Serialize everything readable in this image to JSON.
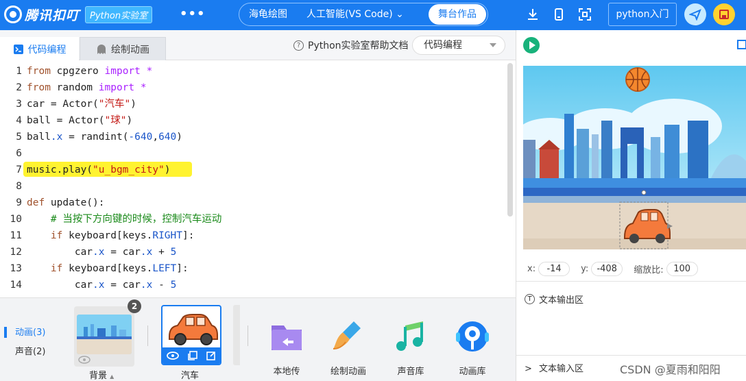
{
  "header": {
    "brand": "腾讯扣叮",
    "lab": "Python实验室",
    "more": "•••",
    "modes": [
      "海龟绘图",
      "人工智能(VS Code)",
      "舞台作品"
    ],
    "active_mode": "舞台作品",
    "python_btn": "python入门",
    "accent": "#1a7cf0"
  },
  "tabs": {
    "code_tab": "代码编程",
    "draw_tab": "绘制动画",
    "help": "Python实验室帮助文档",
    "select_value": "代码编程"
  },
  "code": [
    {
      "n": "1"
    },
    {
      "n": "2"
    },
    {
      "n": "3"
    },
    {
      "n": "4"
    },
    {
      "n": "5"
    },
    {
      "n": "6"
    },
    {
      "n": "7"
    },
    {
      "n": "8"
    },
    {
      "n": "9"
    },
    {
      "n": "10"
    },
    {
      "n": "11"
    },
    {
      "n": "12"
    },
    {
      "n": "13"
    },
    {
      "n": "14"
    }
  ],
  "code_text": {
    "l1": [
      "from",
      " cpgzero ",
      "import",
      " *"
    ],
    "l2": [
      "from",
      " random ",
      "import",
      " *"
    ],
    "l3": [
      "car = Actor(",
      "\"汽车\"",
      ")"
    ],
    "l4": [
      "ball = Actor(",
      "\"球\"",
      ")"
    ],
    "l5": [
      "ball",
      ".x",
      " = randint(",
      "-640",
      ",",
      "640",
      ")"
    ],
    "l7": [
      "music.play(",
      "\"u_bgm_city\"",
      ")"
    ],
    "l9": [
      "def",
      " update():"
    ],
    "l10": [
      "    # 当按下方向键的时候，控制汽车运动"
    ],
    "l11": [
      "    ",
      "if",
      " keyboard[keys.",
      "RIGHT",
      "]:"
    ],
    "l12": [
      "        car",
      ".x",
      " = car",
      ".x",
      " + ",
      "5"
    ],
    "l13": [
      "    ",
      "if",
      " keyboard[keys.",
      "LEFT",
      "]:"
    ],
    "l14": [
      "        car",
      ".x",
      " = car",
      ".x",
      " - ",
      "5"
    ]
  },
  "bottom": {
    "nav": [
      "动画(3)",
      "声音(2)"
    ],
    "bg_count": "2",
    "bg_label": "背景",
    "car_label": "汽车",
    "tools": [
      "本地传",
      "绘制动画",
      "声音库",
      "动画库"
    ]
  },
  "stage": {
    "x_label": "x:",
    "x": "-14",
    "y_label": "y:",
    "y": "-408",
    "scale_label": "缩放比:",
    "scale": "100",
    "output": "文本输出区",
    "input": "文本输入区"
  },
  "watermark": "CSDN @夏雨和阳阳"
}
